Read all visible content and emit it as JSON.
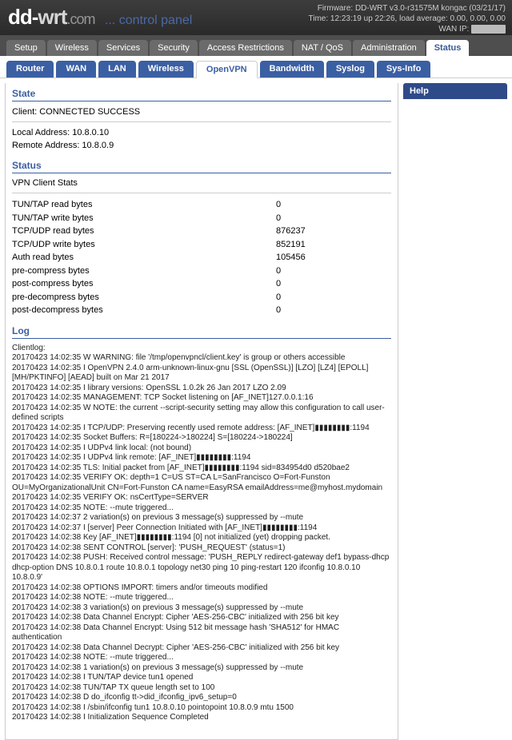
{
  "header": {
    "logo_pre": "dd-",
    "logo_mid": "wrt",
    "logo_dot": ".",
    "logo_com": "com",
    "logo_cp": "... control panel",
    "firmware": "Firmware: DD-WRT v3.0-r31575M kongac (03/21/17)",
    "time": "Time: 12:23:19 up 22:26, load average: 0.00, 0.00, 0.00",
    "wanip": "WAN IP: "
  },
  "maintabs": [
    "Setup",
    "Wireless",
    "Services",
    "Security",
    "Access Restrictions",
    "NAT / QoS",
    "Administration",
    "Status"
  ],
  "maintab_active": 7,
  "subtabs": [
    "Router",
    "WAN",
    "LAN",
    "Wireless",
    "OpenVPN",
    "Bandwidth",
    "Syslog",
    "Sys-Info"
  ],
  "subtab_active": 4,
  "help_title": "Help",
  "sections": {
    "state": {
      "title": "State",
      "client_line": "Client: CONNECTED SUCCESS",
      "local": "Local Address: 10.8.0.10",
      "remote": "Remote Address: 10.8.0.9"
    },
    "status": {
      "title": "Status",
      "subhead": "VPN Client Stats",
      "rows": [
        {
          "k": "TUN/TAP read bytes",
          "v": "0"
        },
        {
          "k": "TUN/TAP write bytes",
          "v": "0"
        },
        {
          "k": "TCP/UDP read bytes",
          "v": "876237"
        },
        {
          "k": "TCP/UDP write bytes",
          "v": "852191"
        },
        {
          "k": "Auth read bytes",
          "v": "105456"
        },
        {
          "k": "pre-compress bytes",
          "v": "0"
        },
        {
          "k": "post-compress bytes",
          "v": "0"
        },
        {
          "k": "pre-decompress bytes",
          "v": "0"
        },
        {
          "k": "post-decompress bytes",
          "v": "0"
        }
      ]
    },
    "log": {
      "title": "Log",
      "lines": [
        "Clientlog:",
        "20170423 14:02:35 W WARNING: file '/tmp/openvpncl/client.key' is group or others accessible",
        "20170423 14:02:35 I OpenVPN 2.4.0 arm-unknown-linux-gnu [SSL (OpenSSL)] [LZO] [LZ4] [EPOLL] [MH/PKTINFO] [AEAD] built on Mar 21 2017",
        "20170423 14:02:35 I library versions: OpenSSL 1.0.2k 26 Jan 2017 LZO 2.09",
        "20170423 14:02:35 MANAGEMENT: TCP Socket listening on [AF_INET]127.0.0.1:16",
        "20170423 14:02:35 W NOTE: the current --script-security setting may allow this configuration to call user-defined scripts",
        "20170423 14:02:35 I TCP/UDP: Preserving recently used remote address: [AF_INET]▮▮▮▮▮▮▮▮:1194",
        "20170423 14:02:35 Socket Buffers: R=[180224->180224] S=[180224->180224]",
        "20170423 14:02:35 I UDPv4 link local: (not bound)",
        "20170423 14:02:35 I UDPv4 link remote: [AF_INET]▮▮▮▮▮▮▮▮:1194",
        "20170423 14:02:35 TLS: Initial packet from [AF_INET]▮▮▮▮▮▮▮▮:1194 sid=834954d0 d520bae2",
        "20170423 14:02:35 VERIFY OK: depth=1 C=US ST=CA L=SanFrancisco O=Fort-Funston OU=MyOrganizationalUnit CN=Fort-Funston CA name=EasyRSA emailAddress=me@myhost.mydomain",
        "20170423 14:02:35 VERIFY OK: nsCertType=SERVER",
        "20170423 14:02:35 NOTE: --mute triggered...",
        "20170423 14:02:37 2 variation(s) on previous 3 message(s) suppressed by --mute",
        "20170423 14:02:37 I [server] Peer Connection Initiated with [AF_INET]▮▮▮▮▮▮▮▮:1194",
        "20170423 14:02:38 Key [AF_INET]▮▮▮▮▮▮▮▮:1194 [0] not initialized (yet) dropping packet.",
        "20170423 14:02:38 SENT CONTROL [server]: 'PUSH_REQUEST' (status=1)",
        "20170423 14:02:38 PUSH: Received control message: 'PUSH_REPLY redirect-gateway def1 bypass-dhcp dhcp-option DNS 10.8.0.1 route 10.8.0.1 topology net30 ping 10 ping-restart 120 ifconfig 10.8.0.10 10.8.0.9'",
        "20170423 14:02:38 OPTIONS IMPORT: timers and/or timeouts modified",
        "20170423 14:02:38 NOTE: --mute triggered...",
        "20170423 14:02:38 3 variation(s) on previous 3 message(s) suppressed by --mute",
        "20170423 14:02:38 Data Channel Encrypt: Cipher 'AES-256-CBC' initialized with 256 bit key",
        "20170423 14:02:38 Data Channel Encrypt: Using 512 bit message hash 'SHA512' for HMAC authentication",
        "20170423 14:02:38 Data Channel Decrypt: Cipher 'AES-256-CBC' initialized with 256 bit key",
        "20170423 14:02:38 NOTE: --mute triggered...",
        "20170423 14:02:38 1 variation(s) on previous 3 message(s) suppressed by --mute",
        "20170423 14:02:38 I TUN/TAP device tun1 opened",
        "20170423 14:02:38 TUN/TAP TX queue length set to 100",
        "20170423 14:02:38 D do_ifconfig tt->did_ifconfig_ipv6_setup=0",
        "20170423 14:02:38 I /sbin/ifconfig tun1 10.8.0.10 pointopoint 10.8.0.9 mtu 1500",
        "20170423 14:02:38 I Initialization Sequence Completed"
      ]
    }
  }
}
